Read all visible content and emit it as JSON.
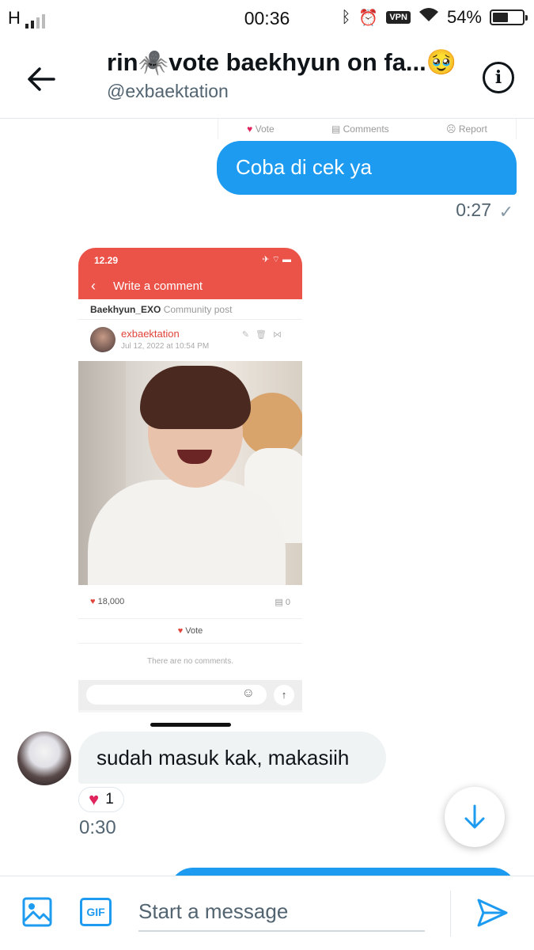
{
  "status_bar": {
    "network": "H",
    "time": "00:36",
    "vpn": "VPN",
    "battery": "54%",
    "battery_level": 0.54
  },
  "header": {
    "title": "rin🕷️vote baekhyun on fa...🥹",
    "handle": "@exbaektation",
    "info_icon": "i"
  },
  "conversation": {
    "cutoff_actions": [
      "Vote",
      "Comments",
      "Report"
    ],
    "outgoing_message": {
      "text": "Coba di cek ya",
      "time": "0:27",
      "status": "✓"
    },
    "shared_screenshot": {
      "status_time": "12.29",
      "status_icons": "✈ ⌔ ▬",
      "page_title": "Write a comment",
      "community": "Baekhyun_EXO",
      "community_suffix": "Community post",
      "author": "exbaektation",
      "date": "Jul 12, 2022 at 10:54 PM",
      "likes": "18,000",
      "comments_count": "0",
      "vote_label": "Vote",
      "empty_comments": "There are no comments."
    },
    "incoming_message": {
      "text": "sudah masuk kak, makasiih",
      "reaction_count": "1",
      "time": "0:30"
    }
  },
  "composer": {
    "placeholder": "Start a message",
    "gif_label": "GIF"
  },
  "colors": {
    "accent": "#1d9bf0",
    "app_red": "#eb5248",
    "heart": "#e0245e"
  }
}
